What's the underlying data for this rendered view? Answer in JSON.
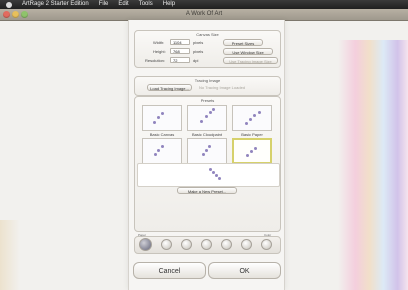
{
  "menubar": {
    "app_name": "ArtRage 2 Starter Edition",
    "items": [
      "File",
      "Edit",
      "Tools",
      "Help"
    ]
  },
  "window": {
    "title": "A Work Of Art"
  },
  "canvas_size": {
    "title": "Canvas Size",
    "width_label": "Width:",
    "width_value": "1104",
    "width_unit": "pixels",
    "height_label": "Height:",
    "height_value": "768",
    "height_unit": "pixels",
    "resolution_label": "Resolution:",
    "resolution_value": "72",
    "resolution_unit": "dpi",
    "preset_sizes_button": "Preset Sizes",
    "use_window_size_button": "Use Window Size",
    "use_tracing_image_size_button": "Use Tracing Image Size"
  },
  "tracing_image": {
    "title": "Tracing Image",
    "load_button": "Load Tracing Image...",
    "no_tracing_text": "No Tracing Image Loaded"
  },
  "presets": {
    "title": "Presets",
    "tiles": [
      {
        "label": "Basic Canvas"
      },
      {
        "label": "Basic Cloudpaint"
      },
      {
        "label": "Basic Paper"
      },
      {
        "label": "Crackled Paper"
      },
      {
        "label": "Rough Canvas"
      },
      {
        "label": "Rough Paper"
      }
    ],
    "left_small_text": "Remove",
    "right_small_text": "Rename",
    "make_new_preset_button": "Make a New Preset..."
  },
  "palette": {
    "left_text": "Paper",
    "right_text": "Color"
  },
  "footer": {
    "cancel_button": "Cancel",
    "ok_button": "OK"
  },
  "colors": {
    "accent_selected": "#d6d16b",
    "paint_purple": "#6c5ca8"
  }
}
